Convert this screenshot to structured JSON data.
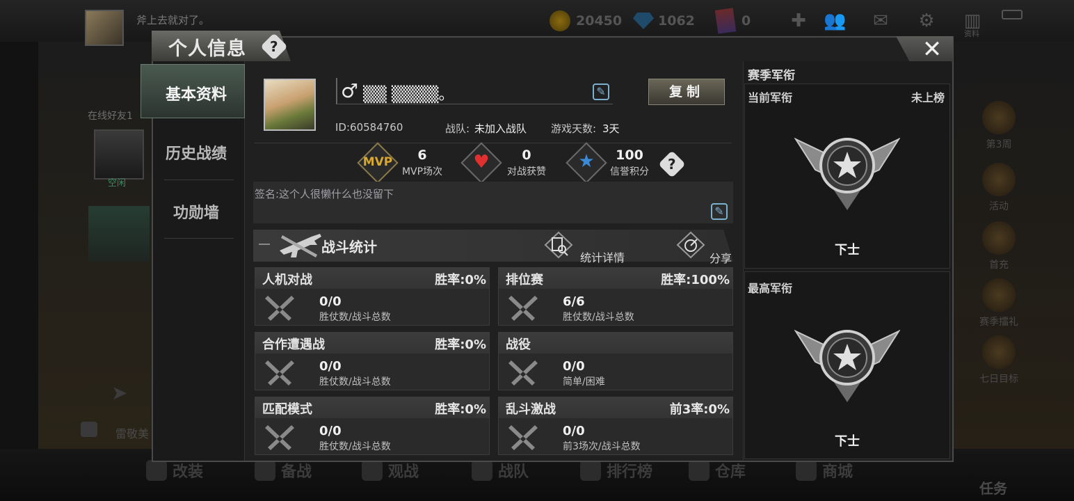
{
  "topbar": {
    "nickname": "斧上去就对了。",
    "coins": "20450",
    "diamonds": "1062",
    "cards": "0",
    "journal_label": "资料"
  },
  "background_left": {
    "friends_online": "在线好友1",
    "friend_name": "空闲",
    "chat_preview": "雷敬美"
  },
  "background_right": {
    "items": [
      "第3周",
      "活动",
      "首充",
      "赛季擂礼",
      "七日目标",
      "任务"
    ]
  },
  "bottom_nav": [
    "改装",
    "备战",
    "观战",
    "战队",
    "排行榜",
    "仓库",
    "商城"
  ],
  "dialog": {
    "title": "个人信息",
    "help": "?",
    "close": "✕"
  },
  "sidebar": {
    "items": [
      "基本资料",
      "历史战绩",
      "功勋墙"
    ],
    "active": 0
  },
  "profile": {
    "gender_symbol": "♂",
    "name": "▒▒  ▒▒▒▒。",
    "copy_label": "复制",
    "id_label": "ID:60584760",
    "team_label": "战队:",
    "team_value": "未加入战队",
    "days_label": "游戏天数:",
    "days_value": "3天"
  },
  "stats": {
    "mvp_icon_text": "MVP",
    "mvp_value": "6",
    "mvp_label": "MVP场次",
    "likes_value": "0",
    "likes_label": "对战获赞",
    "credit_value": "100",
    "credit_label": "信誉积分",
    "help": "?"
  },
  "signature": "签名:这个人很懒什么也没留下",
  "battle": {
    "title": "战斗统计",
    "details_label": "统计详情",
    "share_label": "分享",
    "cards": [
      {
        "name": "人机对战",
        "rate": "胜率:0%",
        "value": "0/0",
        "sub": "胜仗数/战斗总数"
      },
      {
        "name": "排位赛",
        "rate": "胜率:100%",
        "value": "6/6",
        "sub": "胜仗数/战斗总数"
      },
      {
        "name": "合作遭遇战",
        "rate": "胜率:0%",
        "value": "0/0",
        "sub": "胜仗数/战斗总数"
      },
      {
        "name": "战役",
        "rate": "",
        "value": "0/0",
        "sub": "简单/困难"
      },
      {
        "name": "匹配模式",
        "rate": "胜率:0%",
        "value": "0/0",
        "sub": "胜仗数/战斗总数"
      },
      {
        "name": "乱斗激战",
        "rate": "前3率:0%",
        "value": "0/0",
        "sub": "前3场次/战斗总数"
      }
    ]
  },
  "rank": {
    "title": "赛季军衔",
    "current_label": "当前军衔",
    "current_status": "未上榜",
    "current_rank": "下士",
    "highest_label": "最高军衔",
    "highest_rank": "下士"
  },
  "colors": {
    "accent_blue": "#7ab0d0",
    "heart_red": "#e03030",
    "star_blue": "#3a8ad8",
    "mvp_gold": "#d8a830"
  }
}
